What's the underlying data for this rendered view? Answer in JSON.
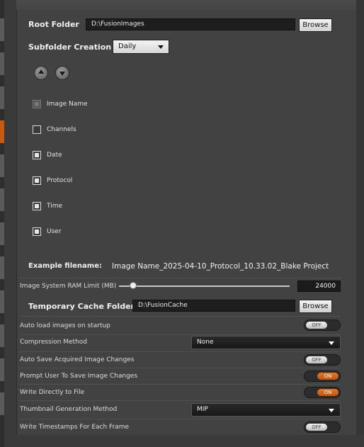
{
  "root_folder": {
    "label": "Root Folder",
    "value": "D:\\FusionImages",
    "browse": "Browse"
  },
  "subfolder": {
    "label": "Subfolder Creation",
    "selected": "Daily"
  },
  "filename_parts": [
    {
      "label": "Image Name",
      "checked": true,
      "disabled": true
    },
    {
      "label": "Channels",
      "checked": false,
      "disabled": false
    },
    {
      "label": "Date",
      "checked": true,
      "disabled": false
    },
    {
      "label": "Protocol",
      "checked": true,
      "disabled": false
    },
    {
      "label": "Time",
      "checked": true,
      "disabled": false
    },
    {
      "label": "User",
      "checked": true,
      "disabled": false
    }
  ],
  "example": {
    "label": "Example filename:",
    "value": "Image Name_2025-04-10_Protocol_10.33.02_Blake Project"
  },
  "ram_limit": {
    "label": "Image System RAM Limit (MB)",
    "value": "24000",
    "fraction": 0.0
  },
  "cache_folder": {
    "label": "Temporary Cache Folder",
    "value": "D:\\FusionCache",
    "browse": "Browse"
  },
  "settings": {
    "auto_load": {
      "label": "Auto load images on startup",
      "state": "OFF"
    },
    "compression": {
      "label": "Compression Method",
      "selected": "None"
    },
    "auto_save": {
      "label": "Auto Save Acquired Image Changes",
      "state": "OFF"
    },
    "prompt_save": {
      "label": "Prompt User To Save Image Changes",
      "state": "ON"
    },
    "write_direct": {
      "label": "Write Directly to File",
      "state": "ON"
    },
    "thumbnail": {
      "label": "Thumbnail Generation Method",
      "selected": "MIP"
    },
    "timestamps": {
      "label": "Write Timestamps For Each Frame",
      "state": "OFF"
    }
  },
  "icons": {
    "move_up": "up-arrow-icon",
    "move_down": "down-arrow-icon",
    "dropdown": "chevron-down-icon"
  },
  "colors": {
    "accent": "#d2631a",
    "panel": "#424242",
    "field": "#1e1e1e"
  }
}
